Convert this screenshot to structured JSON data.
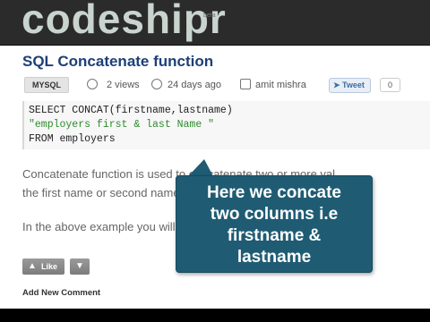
{
  "header": {
    "logo_text": "codeshipr",
    "logo_mark": "beta"
  },
  "article": {
    "title": "SQL Concatenate function",
    "tag": "MYSQL",
    "views": "2 views",
    "age": "24 days ago",
    "author": "amit mishra",
    "tweet_label": "Tweet",
    "tweet_count": "0",
    "code_lines": [
      "SELECT CONCAT(firstname,lastname)",
      "\"employers first & last Name \"",
      "FROM employers"
    ],
    "para1_line1": "Concatenate function is used to concatenate two or more val",
    "para1_line2": "the first name or second name of employers we can concatenate",
    "para2": "In the above example you will get a single column as output.",
    "like_label": "Like",
    "add_comment": "Add New Comment"
  },
  "callout": {
    "lines": [
      "Here we concate",
      "two columns i.e",
      "firstname &",
      "lastname"
    ]
  },
  "colors": {
    "title": "#1d3f77",
    "callout_bg": "#1f5c73",
    "code_string": "#2e8b2e"
  }
}
